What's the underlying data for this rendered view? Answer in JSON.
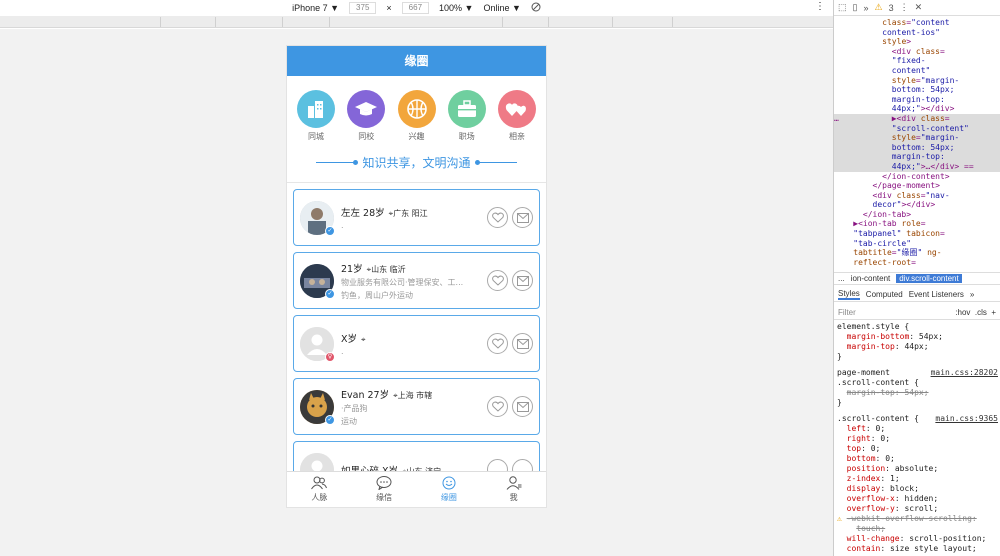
{
  "devbar": {
    "device": "iPhone 7 ▼",
    "width": "375",
    "x": "×",
    "height": "667",
    "zoom": "100% ▼",
    "network": "Online ▼"
  },
  "phone": {
    "title": "缘圈",
    "categories": [
      {
        "label": "同城",
        "color": "#5bc0e0",
        "icon": "building-icon"
      },
      {
        "label": "同校",
        "color": "#8466d8",
        "icon": "graduation-cap-icon"
      },
      {
        "label": "兴趣",
        "color": "#f2a63c",
        "icon": "basketball-icon"
      },
      {
        "label": "职场",
        "color": "#6fcf9f",
        "icon": "briefcase-icon"
      },
      {
        "label": "相亲",
        "color": "#ef7a86",
        "icon": "hearts-icon"
      }
    ],
    "slogan": "知识共享，文明沟通",
    "cards": [
      {
        "name": "左左 28岁",
        "location": "广东 阳江",
        "line2": ".",
        "line3": "",
        "badge": "✓",
        "badge_color": "#3e96e2",
        "avatar_color": "#b8c4cc"
      },
      {
        "name": "21岁",
        "location": "山东 临沂",
        "line2": "物业服务有限公司·管理保安、工...",
        "line3": "钓鱼，周山户外运动",
        "badge": "✓",
        "badge_color": "#3e96e2",
        "avatar_color": "#3a4a5e"
      },
      {
        "name": "X岁",
        "location": "",
        "line2": ".",
        "line3": "",
        "badge": "♀",
        "badge_color": "#e0566a",
        "avatar_color": "#dcdcdc"
      },
      {
        "name": "Evan 27岁",
        "location": "上海 市辖",
        "line2": "·产品狗",
        "line3": "运动",
        "badge": "✓",
        "badge_color": "#3e96e2",
        "avatar_color": "#c9903a"
      },
      {
        "name": "如果心碎 X岁",
        "location": "山东 济宁",
        "line2": "",
        "line3": "",
        "badge": "",
        "badge_color": "#3e96e2",
        "avatar_color": "#dcdcdc"
      }
    ],
    "tabs": [
      {
        "label": "人脉",
        "icon": "people-icon"
      },
      {
        "label": "缘信",
        "icon": "chat-icon"
      },
      {
        "label": "缘圈",
        "icon": "circle-icon"
      },
      {
        "label": "我",
        "icon": "user-icon"
      }
    ]
  },
  "devtools": {
    "warnings": "3",
    "breadcrumb_1": "...",
    "breadcrumb_2": "ion-content",
    "breadcrumb_3": "div.scroll-content",
    "tab_styles": "Styles",
    "tab_computed": "Computed",
    "tab_listeners": "Event Listeners",
    "filter": "Filter",
    "hov": ":hov",
    "cls": ".cls"
  }
}
